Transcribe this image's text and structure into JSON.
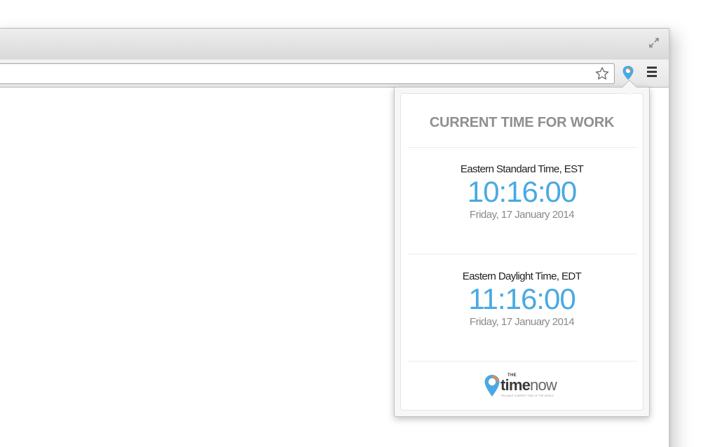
{
  "browser": {
    "omnibox_value": "",
    "icons": {
      "fullscreen": "fullscreen-arrows-icon",
      "bookmark": "star-outline-icon",
      "extension": "map-pin-icon",
      "menu": "hamburger-menu-icon"
    },
    "accent_colors": {
      "extension_pin_blue": "#4aa9e2",
      "extension_pin_orange": "#f08a3a"
    }
  },
  "popup": {
    "title": "CURRENT TIME FOR WORK",
    "zones": [
      {
        "name": "Eastern Standard Time, EST",
        "time": "10:16:00",
        "date": "Friday, 17 January 2014"
      },
      {
        "name": "Eastern Daylight Time, EDT",
        "time": "11:16:00",
        "date": "Friday, 17 January 2014"
      }
    ],
    "logo": {
      "the": "THE",
      "word_bold": "time",
      "word_regular": "now",
      "tagline": "RELIABLE CURRENT TIME OF THE WORLD"
    },
    "colors": {
      "time_blue": "#4aa9e2",
      "title_gray": "#8f8f8f",
      "date_gray": "#8a8a8a"
    }
  }
}
